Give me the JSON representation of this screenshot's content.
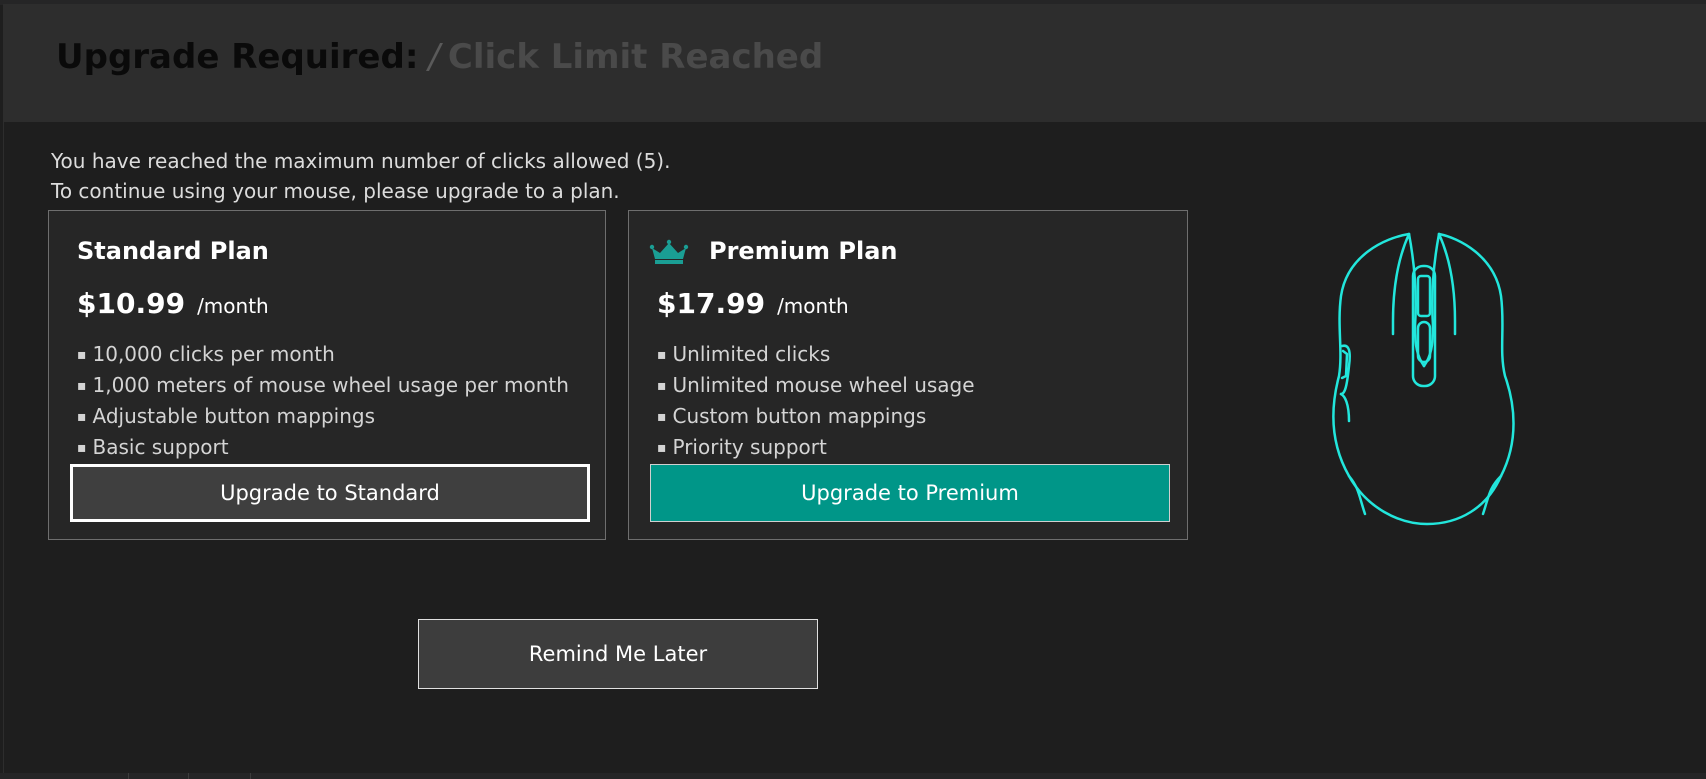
{
  "dialog": {
    "title_main": "Upgrade Required:",
    "title_separator": "/",
    "title_sub": "Click Limit Reached",
    "message_lines": [
      "You have reached the maximum number of clicks allowed (5).",
      "To continue using your mouse, please upgrade to a plan."
    ],
    "accent_color": "#009688",
    "mouse_outline_color": "#22e6dc"
  },
  "plans": {
    "standard": {
      "name": "Standard Plan",
      "price": "$10.99",
      "period": "/month",
      "features": [
        "10,000 clicks per month",
        "1,000 meters of mouse wheel usage per month",
        "Adjustable button mappings",
        "Basic support"
      ],
      "button_label": "Upgrade to Standard"
    },
    "premium": {
      "name": "Premium Plan",
      "icon": "crown-icon",
      "price": "$17.99",
      "period": "/month",
      "features": [
        "Unlimited clicks",
        "Unlimited mouse wheel usage",
        "Custom button mappings",
        "Priority support"
      ],
      "button_label": "Upgrade to Premium"
    }
  },
  "actions": {
    "remind_label": "Remind Me Later"
  },
  "illustration": {
    "icon": "mouse-icon"
  }
}
